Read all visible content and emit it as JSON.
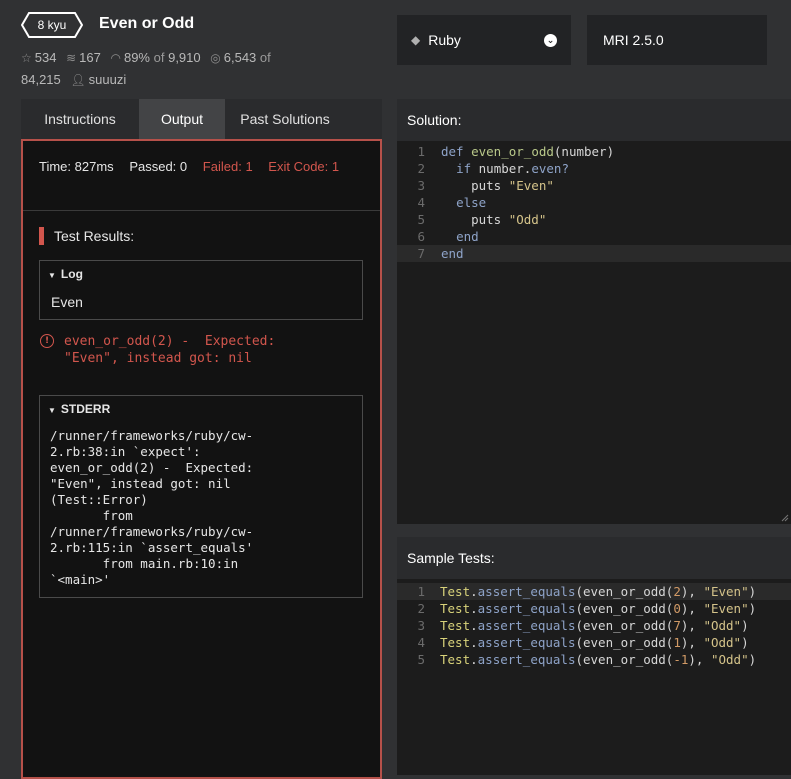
{
  "header": {
    "kyu": "8 kyu",
    "title": "Even or Odd",
    "stats": {
      "stars": "534",
      "collections": "167",
      "satisfaction_pct": "89%",
      "satisfaction_of": "of",
      "satisfaction_total": "9,910",
      "completed": "6,543",
      "completed_of": "of",
      "completed_total": "84,215",
      "author": "suuuzi"
    },
    "icons": {
      "star": "star-icon",
      "collections": "stack-icon",
      "satisfaction": "eye-icon",
      "completed": "target-icon",
      "author": "user-icon"
    },
    "language": "Ruby",
    "version": "MRI 2.5.0"
  },
  "tabs": [
    "Instructions",
    "Output",
    "Past Solutions"
  ],
  "active_tab": "Output",
  "output": {
    "time_label": "Time:",
    "time_value": "827ms",
    "passed_label": "Passed:",
    "passed_value": "0",
    "failed_label": "Failed:",
    "failed_value": "1",
    "exit_label": "Exit Code:",
    "exit_value": "1",
    "results_title": "Test Results:",
    "log_label": "Log",
    "log_text": "Even",
    "error_text": "even_or_odd(2) -  Expected:\n\"Even\", instead got: nil",
    "stderr_label": "STDERR",
    "stderr_text": "/runner/frameworks/ruby/cw-\n2.rb:38:in `expect':\neven_or_odd(2) -  Expected:\n\"Even\", instead got: nil\n(Test::Error)\n       from\n/runner/frameworks/ruby/cw-\n2.rb:115:in `assert_equals'\n       from main.rb:10:in\n`<main>'"
  },
  "solution": {
    "title": "Solution:",
    "line_numbers": [
      "1",
      "2",
      "3",
      "4",
      "5",
      "6",
      "7"
    ]
  },
  "sample_tests": {
    "title": "Sample Tests:",
    "line_numbers": [
      "1",
      "2",
      "3",
      "4",
      "5"
    ],
    "args": [
      "2",
      "0",
      "7",
      "1",
      "-1"
    ],
    "expected": [
      "\"Even\"",
      "\"Even\"",
      "\"Odd\"",
      "\"Odd\"",
      "\"Odd\""
    ]
  },
  "colors": {
    "accent_fail": "#d2564d",
    "panel_border": "#b6514a",
    "background": "#303133"
  }
}
